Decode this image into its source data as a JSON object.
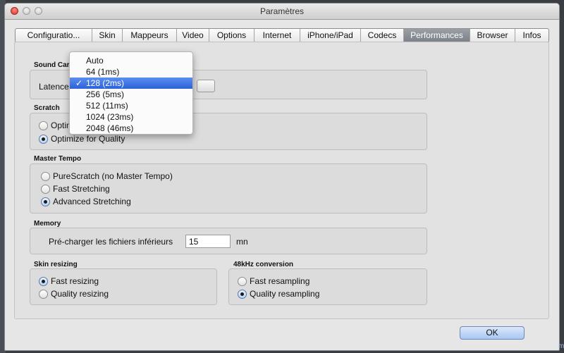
{
  "window": {
    "title": "Paramètres"
  },
  "tabs": [
    {
      "label": "Configuratio..."
    },
    {
      "label": "Skin"
    },
    {
      "label": "Mappeurs"
    },
    {
      "label": "Video"
    },
    {
      "label": "Options"
    },
    {
      "label": "Internet"
    },
    {
      "label": "iPhone/iPad"
    },
    {
      "label": "Codecs"
    },
    {
      "label": "Performances",
      "active": true
    },
    {
      "label": "Browser"
    },
    {
      "label": "Infos"
    }
  ],
  "sound_card": {
    "group_label": "Sound Card",
    "latency_label": "Latence :",
    "selected_value": "128 (2ms)",
    "options": [
      "Auto",
      "64 (1ms)",
      "128 (2ms)",
      "256 (5ms)",
      "512 (11ms)",
      "1024 (23ms)",
      "2048 (46ms)"
    ]
  },
  "scratch": {
    "group_label": "Scratch",
    "option1": "Optim",
    "option2": "Optimize for Quality"
  },
  "master_tempo": {
    "group_label": "Master Tempo",
    "options": [
      "PureScratch (no Master Tempo)",
      "Fast Stretching",
      "Advanced Stretching"
    ],
    "selected": "Advanced Stretching"
  },
  "memory": {
    "group_label": "Memory",
    "preload_label": "Pré-charger les fichiers inférieurs",
    "preload_value": "15",
    "unit": "mn"
  },
  "skin_resizing": {
    "group_label": "Skin resizing",
    "options": [
      "Fast resizing",
      "Quality resizing"
    ],
    "selected": "Fast resizing"
  },
  "conversion_48khz": {
    "group_label": "48kHz conversion",
    "options": [
      "Fast resampling",
      "Quality resampling"
    ],
    "selected": "Quality resampling"
  },
  "footer": {
    "ok_label": "OK"
  },
  "check_glyph": "✓",
  "external": {
    "side_mark": "m"
  }
}
